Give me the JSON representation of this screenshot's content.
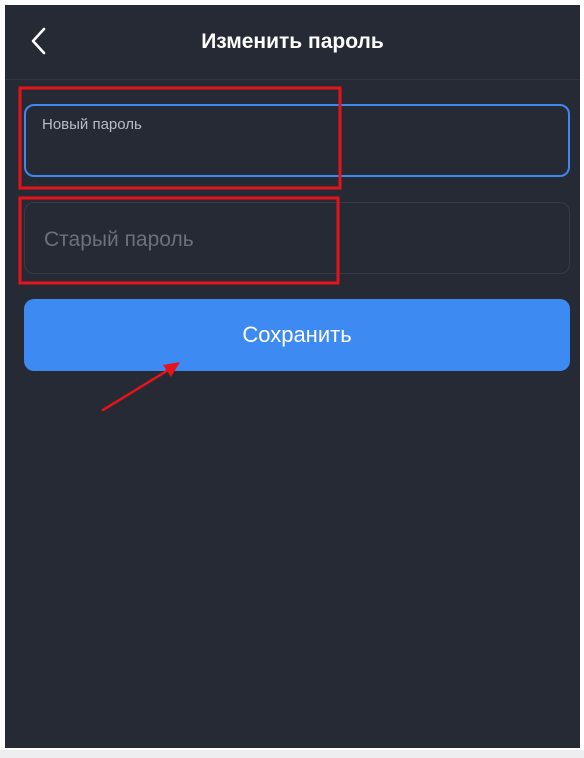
{
  "header": {
    "title": "Изменить пароль",
    "back_icon": "chevron-left-icon"
  },
  "form": {
    "new_password": {
      "label": "Новый пароль",
      "value": ""
    },
    "old_password": {
      "placeholder": "Старый пароль",
      "value": ""
    },
    "save_label": "Сохранить"
  },
  "colors": {
    "background": "#262a34",
    "accent": "#3e8af3",
    "annotation": "#e5141b"
  }
}
